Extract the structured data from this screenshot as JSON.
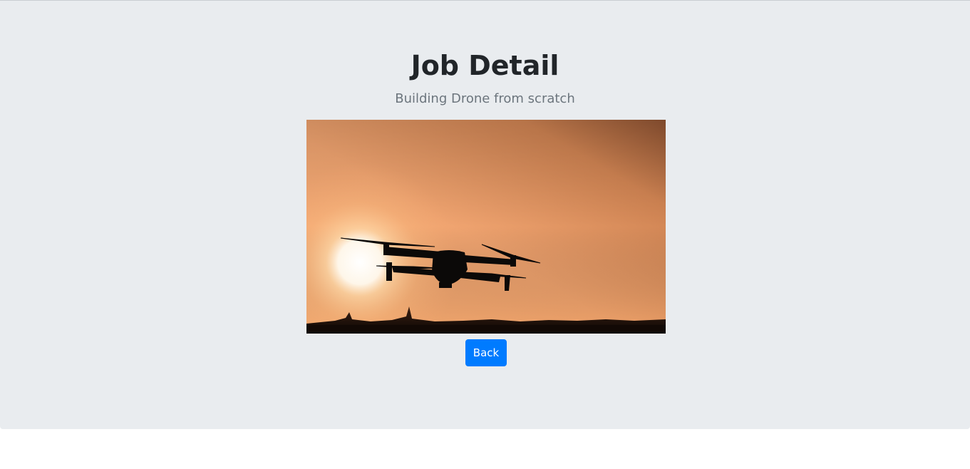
{
  "header": {
    "title": "Job Detail",
    "subtitle": "Building Drone from scratch"
  },
  "image": {
    "subject": "drone-silhouette-at-sunset"
  },
  "actions": {
    "back_label": "Back"
  },
  "colors": {
    "background": "#e9ecef",
    "title_text": "#212529",
    "subtitle_text": "#6c757d",
    "button_primary": "#007bff",
    "button_text": "#ffffff"
  }
}
